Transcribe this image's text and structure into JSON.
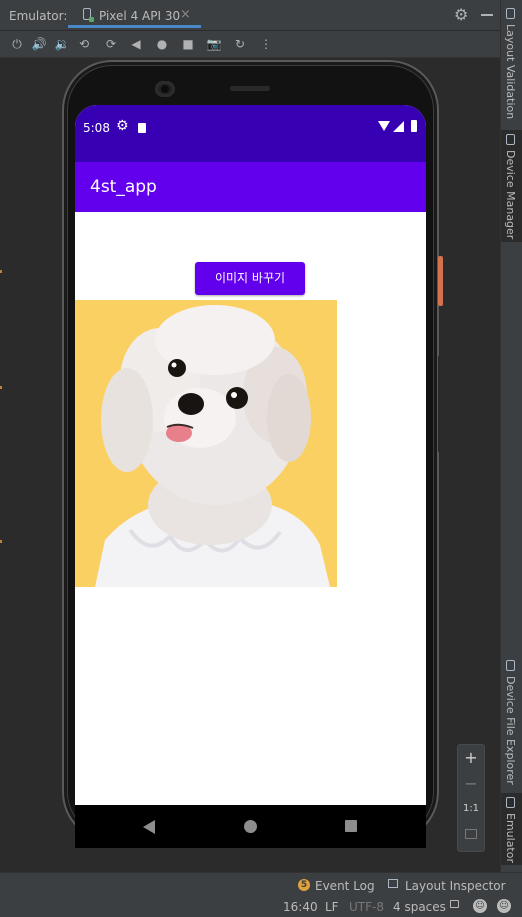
{
  "tool_window": {
    "title": "Emulator:",
    "device_tab": "Pixel 4 API 30",
    "close_glyph": "×"
  },
  "toolbar": {
    "icons": [
      "power-icon",
      "volume-up-icon",
      "volume-down-icon",
      "rotate-left-icon",
      "rotate-right-icon",
      "back-icon",
      "home-icon",
      "overview-icon",
      "screenshot-icon",
      "snapshot-icon",
      "more-icon"
    ]
  },
  "side_panel": {
    "items": [
      "Layout Validation",
      "Device Manager",
      "Device File Explorer",
      "Emulator"
    ]
  },
  "device": {
    "status_bar": {
      "time": "5:08"
    },
    "app_bar": {
      "title": "4st_app"
    },
    "button": {
      "label": "이미지 바꾸기"
    },
    "colors": {
      "primary": "#6200ee",
      "primary_dark": "#3700b3",
      "image_bg": "#fbd063"
    }
  },
  "zoom_panel": {
    "zoom_in": "+",
    "zoom_out": "−",
    "one_to_one": "1:1"
  },
  "status_bar": {
    "event_log_count": "5",
    "event_log": "Event Log",
    "layout_inspector": "Layout Inspector",
    "position": "16:40",
    "line_sep": "LF",
    "encoding": "UTF-8",
    "indent": "4 spaces"
  }
}
